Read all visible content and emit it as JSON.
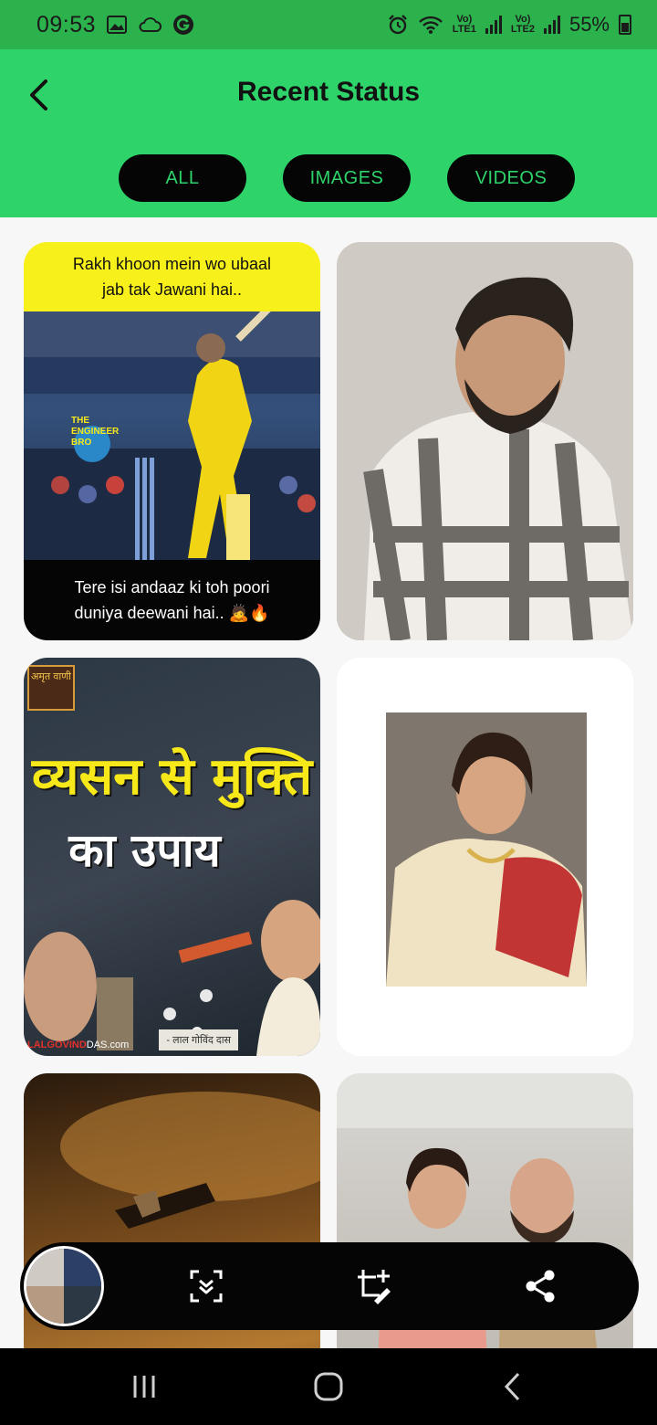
{
  "status_bar": {
    "time": "09:53",
    "battery": "55%",
    "sim1": "Vo)\nLTE1",
    "sim2": "Vo)\nLTE2",
    "icons": [
      "gallery-icon",
      "cloud-icon",
      "g-icon",
      "alarm-icon",
      "wifi-icon",
      "signal-icon",
      "battery-icon"
    ]
  },
  "header": {
    "title": "Recent Status",
    "back_icon": "back-arrow-icon",
    "tabs": [
      {
        "label": "ALL"
      },
      {
        "label": "IMAGES"
      },
      {
        "label": "VIDEOS"
      }
    ]
  },
  "cards": [
    {
      "kind": "image",
      "top_text_1": "Rakh khoon mein wo ubaal",
      "top_text_2": "jab tak Jawani hai..",
      "bottom_text_1": "Tere isi andaaz ki toh poori",
      "bottom_text_2": "duniya deewani hai.. 🙇🔥",
      "logo_text": "THE ENGINEER BRO"
    },
    {
      "kind": "image",
      "description": "man-in-checked-shirt-photo"
    },
    {
      "kind": "image",
      "headline_1": "व्यसन से मुक्ति",
      "headline_2": "का उपाय",
      "badge": "अमृत वाणी",
      "caption": "- लाल गोविंद दास",
      "site_prefix": "LALGOVIND",
      "site_suffix": "DAS.com"
    },
    {
      "kind": "image",
      "description": "woman-in-saree-photo"
    },
    {
      "kind": "video",
      "description": "pen-writing-photo"
    },
    {
      "kind": "image",
      "description": "couple-photo"
    }
  ],
  "action_bar": {
    "buttons": [
      "download-icon",
      "crop-edit-icon",
      "share-icon"
    ]
  },
  "nav_bar": {
    "buttons": [
      "recent-apps-icon",
      "home-icon",
      "back-icon"
    ]
  },
  "colors": {
    "status_bar": "#2bb24c",
    "header": "#2ed46a",
    "tab_bg": "#050505",
    "tab_text": "#2ed46a",
    "card1_top": "#f7f01a"
  }
}
